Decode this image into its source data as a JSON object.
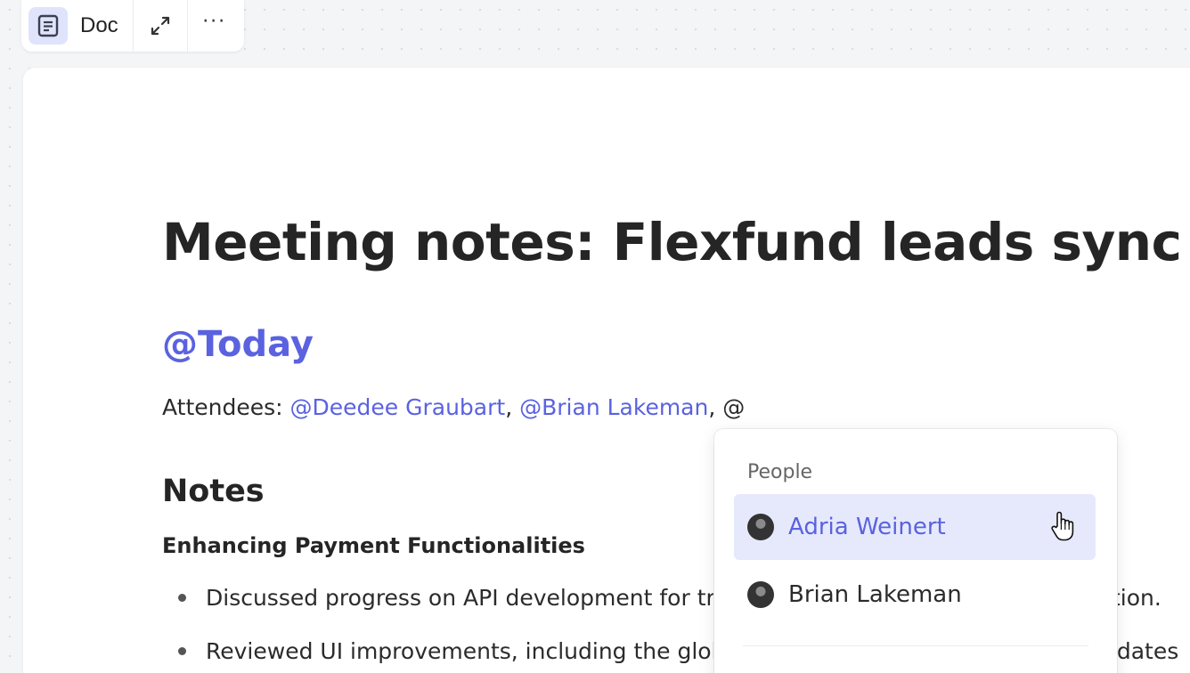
{
  "toolbar": {
    "doc_label": "Doc",
    "doc_icon": "document-icon",
    "expand_icon": "expand-icon",
    "more_label": "···"
  },
  "document": {
    "title": "Meeting notes: Flexfund leads sync",
    "date_mention": "@Today",
    "attendees": {
      "label": "Attendees: ",
      "mentions": [
        "@Deedee Graubart",
        "@Brian Lakeman"
      ],
      "separator": ", ",
      "typing": ", @"
    },
    "notes_heading": "Notes",
    "subheading": "Enhancing Payment Functionalities",
    "bullets": [
      {
        "visible_start": "Discussed progress on API development for tr",
        "visible_end": "tion."
      },
      {
        "visible_start": "Reviewed UI improvements, including the glob",
        "visible_end": "pdates"
      }
    ]
  },
  "mention_popup": {
    "section_label": "People",
    "people": [
      {
        "name": "Adria Weinert",
        "selected": true
      },
      {
        "name": "Brian Lakeman",
        "selected": false
      }
    ]
  },
  "colors": {
    "accent": "#5a62e0",
    "selected_bg": "#e6e9fb",
    "icon_bg": "#dfe3fb"
  }
}
